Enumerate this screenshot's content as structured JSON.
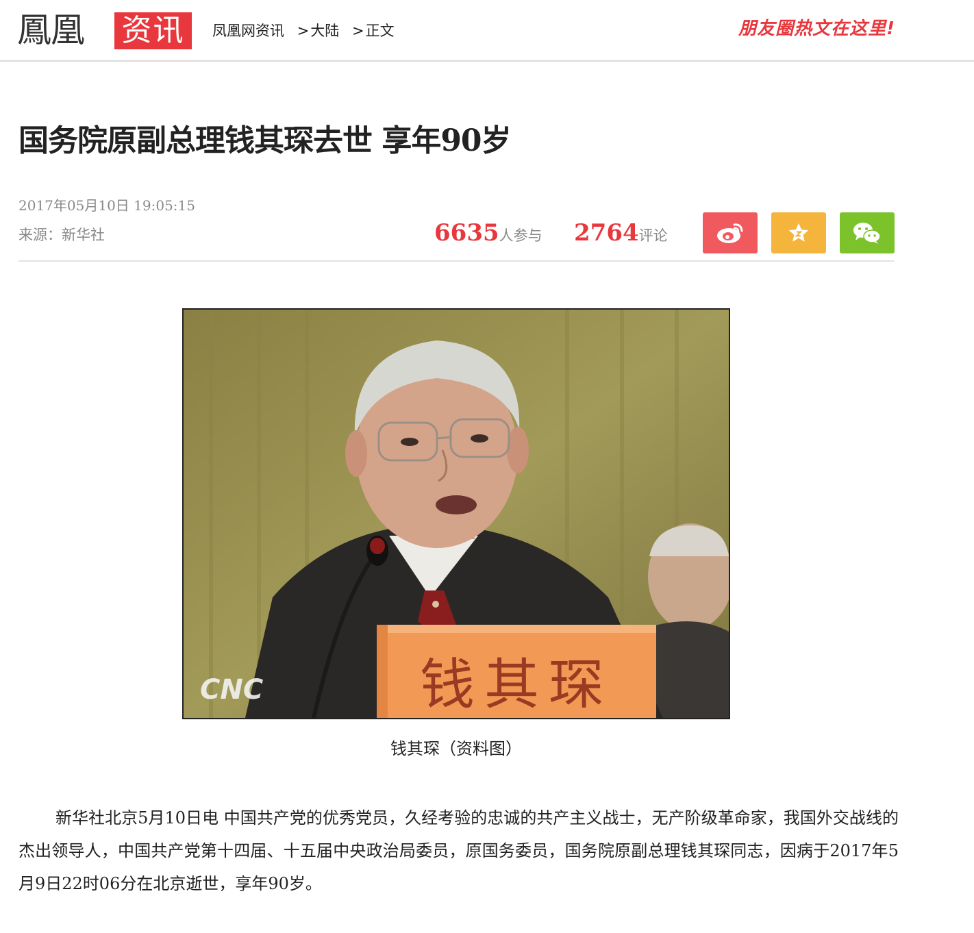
{
  "header": {
    "logo": "鳳凰",
    "logo_badge": "资讯",
    "breadcrumb": [
      "凤凰网资讯",
      "大陆",
      "正文"
    ],
    "breadcrumb_separator": ">",
    "hot_link": "朋友圈热文在这里!"
  },
  "article": {
    "title": "国务院原副总理钱其琛去世 享年90岁",
    "date": "2017年05月10日  19:05:15",
    "source": "来源：新华社",
    "participants": "6635",
    "participants_label": "人参与",
    "comments": "2764",
    "comments_label": "评论",
    "photo": {
      "nameplate": "钱其琛",
      "watermark": "CNC"
    },
    "caption": "钱其琛（资料图）",
    "paragraph": "新华社北京5月10日电  中国共产党的优秀党员，久经考验的忠诚的共产主义战士，无产阶级革命家，我国外交战线的杰出领导人，中国共产党第十四届、十五届中央政治局委员，原国务委员，国务院原副总理钱其琛同志，因病于2017年5月9日22时06分在北京逝世，享年90岁。"
  },
  "share": {
    "icons": [
      "weibo-icon",
      "star-icon",
      "wechat-icon"
    ],
    "colors": {
      "weibo": "#f05a5f",
      "favorite": "#f5b43c",
      "wechat": "#7bc22b"
    }
  },
  "colors": {
    "accent": "#e8373d",
    "meta": "#888888"
  }
}
